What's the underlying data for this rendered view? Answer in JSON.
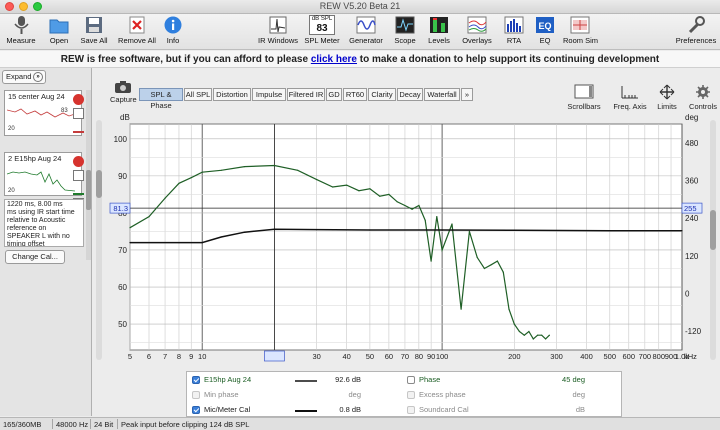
{
  "window": {
    "title": "REW V5.20 Beta 21"
  },
  "toolbar": {
    "measure": "Measure",
    "open": "Open",
    "save_all": "Save All",
    "remove_all": "Remove All",
    "info": "Info",
    "ir_windows": "IR Windows",
    "spl_meter_caption": "dB SPL",
    "spl_meter_value": "83",
    "spl_meter": "SPL Meter",
    "generator": "Generator",
    "scope": "Scope",
    "levels": "Levels",
    "overlays": "Overlays",
    "rta": "RTA",
    "eq": "EQ",
    "room_sim": "Room Sim",
    "preferences": "Preferences"
  },
  "donate": {
    "before": "REW is free software, but if you can afford to please ",
    "link": "click here",
    "after": " to make a donation to help support its continuing development"
  },
  "left_panel": {
    "expand_label": "Expand",
    "measurements": [
      {
        "number": "",
        "label": "15 center Aug 24",
        "plot_scale_top": "83",
        "plot_scale_bottom": "20"
      },
      {
        "number": "2",
        "label": "E15hp Aug 24",
        "plot_scale_top": "",
        "plot_scale_bottom": "20"
      }
    ],
    "notes": "ms using IR start time relative to Acoustic reference on SPEAKER L with no timing offset",
    "notes_top": "1220 ms, 8.00 ms",
    "change_cal": "Change Cal..."
  },
  "tabs": [
    "SPL & Phase",
    "All SPL",
    "Distortion",
    "Impulse",
    "Filtered IR",
    "GD",
    "RT60",
    "Clarity",
    "Decay",
    "Waterfall",
    "»"
  ],
  "active_tab": "SPL & Phase",
  "capture_label": "Capture",
  "right_tools": {
    "scrollbars": "Scrollbars",
    "freq_axis": "Freq. Axis",
    "limits": "Limits",
    "controls": "Controls"
  },
  "chart_data": {
    "type": "line",
    "ylabel": "dB",
    "y2label": "deg",
    "xunit": "kHz",
    "ylim": [
      43,
      104
    ],
    "y2lim": [
      -180,
      540
    ],
    "yticks": [
      "100",
      "90",
      "80",
      "70",
      "60",
      "50"
    ],
    "y2ticks": [
      "480",
      "360",
      "240",
      "120",
      "0",
      "-120"
    ],
    "xticks": [
      "5",
      "6",
      "7",
      "8",
      "9",
      "10",
      "20.0",
      "30",
      "40",
      "50",
      "60",
      "70",
      "80",
      "90",
      "100",
      "200",
      "300",
      "400",
      "500",
      "600",
      "700",
      "800",
      "900",
      "1.0k"
    ],
    "cursor": {
      "x_label": "20.0",
      "y_label": "81.3",
      "y2_label": "255"
    },
    "grid": true,
    "series": [
      {
        "name": "E15hp Aug 24",
        "color": "#1f5f26",
        "axis": "left",
        "x": [
          5,
          6,
          7,
          8,
          9,
          10,
          12,
          15,
          20,
          25,
          30,
          35,
          40,
          45,
          50,
          55,
          60,
          65,
          70,
          75,
          80,
          85,
          90,
          95,
          100,
          110,
          120,
          130,
          140,
          150,
          160,
          170,
          180,
          190,
          200,
          210,
          220,
          230,
          240,
          250,
          260,
          270,
          280
        ],
        "y": [
          76,
          79,
          84,
          88,
          89.5,
          91,
          91.5,
          92.5,
          92.8,
          91.5,
          89,
          87,
          87.5,
          86,
          86.5,
          84.5,
          85,
          83,
          82,
          81,
          82,
          78,
          67,
          79,
          70,
          77,
          54,
          75,
          68,
          65,
          66,
          67,
          64,
          54,
          50,
          48,
          47,
          48,
          46,
          47,
          47,
          46,
          47
        ]
      },
      {
        "name": "Mic/Meter Cal",
        "color": "#111111",
        "axis": "left",
        "x": [
          5,
          8,
          10,
          12,
          15,
          20,
          30,
          50,
          100,
          200,
          500,
          1000
        ],
        "y": [
          72,
          72,
          72,
          73.5,
          74.8,
          75.6,
          75.5,
          75.4,
          75.4,
          75.3,
          75.2,
          75.2
        ]
      }
    ]
  },
  "legend": {
    "rows": [
      {
        "name": "E15hp Aug 24",
        "value": "92.6 dB",
        "right_name": "Phase",
        "right_value": "45 deg"
      },
      {
        "name": "Min phase",
        "value": "deg",
        "right_name": "Excess phase",
        "right_value": "deg"
      },
      {
        "name": "Mic/Meter Cal",
        "value": "0.8 dB",
        "right_name": "Soundcard Cal",
        "right_value": "dB"
      }
    ]
  },
  "status": {
    "memory": "165/360MB",
    "rate": "48000 Hz",
    "bits": "24 Bit",
    "message": "Peak input before clipping 124 dB SPL"
  }
}
